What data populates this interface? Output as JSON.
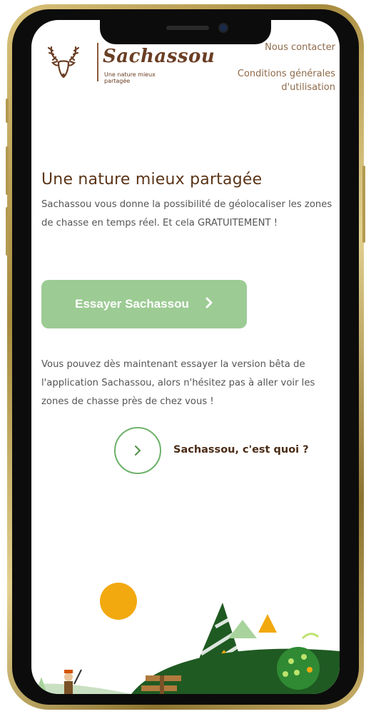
{
  "header": {
    "brand": "Sachassou",
    "tagline": "Une nature mieux partagée",
    "nav_contact": "Nous contacter",
    "nav_cgu": "Conditions générales d'utilisation"
  },
  "hero": {
    "title": "Une nature mieux partagée",
    "text": "Sachassou vous donne la possibilité de géolocaliser les zones de chasse en temps réel. Et cela GRATUITEMENT !",
    "cta_label": "Essayer Sachassou",
    "cta_icon": "chevron-right-icon"
  },
  "beta": {
    "text": "Vous pouvez dès maintenant essayer la version bêta de l'application Sachassou, alors n'hésitez pas à aller voir les zones de chasse près de chez vous !"
  },
  "about": {
    "label": "Sachassou, c'est quoi ?",
    "icon": "chevron-right-icon"
  },
  "colors": {
    "brand_brown": "#6a3e24",
    "cta_green": "#9ccb94",
    "hill_green": "#1f5a22",
    "sun": "#f2a90f"
  }
}
